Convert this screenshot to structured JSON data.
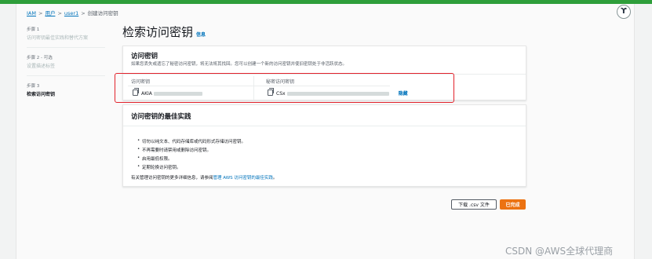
{
  "breadcrumb": {
    "items": [
      "IAM",
      "用户",
      "user1",
      "创建访问密钥"
    ]
  },
  "steps": [
    {
      "num": "步骤 1",
      "title": "访问密钥最佳实践和替代方案"
    },
    {
      "num": "步骤 2 - 可选",
      "title": "设置描述标签"
    },
    {
      "num": "步骤 3",
      "title": "检索访问密钥"
    }
  ],
  "page": {
    "title": "检索访问密钥",
    "info_label": "信息"
  },
  "access_key_panel": {
    "title": "访问密钥",
    "description": "如果您丢失或遗忘了秘密访问密钥，将无法将其找回。您可以创建一个新的访问密钥并使旧密钥处于非活跃状态。",
    "access_key_header": "访问密钥",
    "secret_key_header": "秘密访问密钥",
    "access_key_value": "AKIA",
    "secret_key_value": "CSx",
    "show_label": "隐藏"
  },
  "best_practices": {
    "title": "访问密钥的最佳实践",
    "items": [
      "切勿以纯文本、代码存储库或代码形式存储访问密钥。",
      "不再需要时请禁用或删除访问密钥。",
      "启用最低权限。",
      "定期轮换访问密钥。"
    ],
    "footer_prefix": "有关管理访问密钥的更多详细信息，请参阅",
    "footer_link": "管理 AWS 访问密钥的最佳实践",
    "footer_suffix": "。"
  },
  "actions": {
    "download_label": "下载 .csv 文件",
    "done_label": "已完成"
  },
  "watermark": "CSDN @AWS全球代理商",
  "colors": {
    "primary": "#ec7211",
    "link": "#0073bb",
    "highlight": "#e2222b",
    "topbar": "#2e9e3a"
  }
}
